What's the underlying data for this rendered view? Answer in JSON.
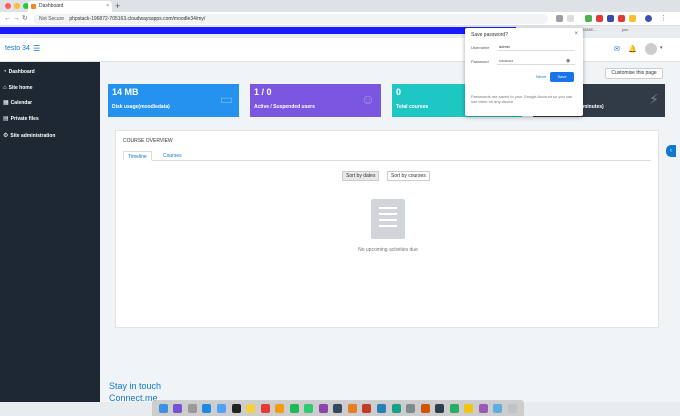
{
  "browser": {
    "tab_title": "Dashboard",
    "tab_close": "×",
    "new_tab": "+",
    "url_secure": "Not Secure",
    "url_text": "phpstack-196872-705163.cloudwaysapps.com/moodle34/my/",
    "bookmarks": [
      "SMS MANAGEME...",
      "jom"
    ]
  },
  "header": {
    "brand": "testo 34",
    "menu_icon": "☰",
    "messages_icon": "✉",
    "notifications_icon": "🔔",
    "user_caret": "▾"
  },
  "sidebar": {
    "items": [
      {
        "label": "Dashboard",
        "icon": "◔"
      },
      {
        "label": "Site home",
        "icon": "⌂"
      },
      {
        "label": "Calendar",
        "icon": "▦"
      },
      {
        "label": "Private files",
        "icon": "▤"
      },
      {
        "label": "Site administration",
        "icon": "⚙"
      }
    ]
  },
  "main": {
    "customise_label": "Customise this page",
    "stats": [
      {
        "value": "14 MB",
        "label": "Disk usage(moodledata)",
        "color": "#2592f0"
      },
      {
        "value": "1 / 0",
        "label": "Active / Suspended users",
        "color": "#7b56e0"
      },
      {
        "value": "0",
        "label": "Total courses",
        "color": "#1fc7c4"
      },
      {
        "value": "",
        "label": "(5 minutes)",
        "color": "#313b48"
      }
    ],
    "course_overview": {
      "title": "COURSE OVERVIEW",
      "tabs": [
        "Timeline",
        "Courses"
      ],
      "sort_buttons": [
        "Sort by dates",
        "Sort by courses"
      ],
      "empty_text": "No upcoming activities due"
    },
    "footer": {
      "stay_in_touch": "Stay in touch",
      "connect": "Connect.me"
    }
  },
  "password_popup": {
    "title": "Save password?",
    "close": "×",
    "username_label": "Username",
    "username_value": "admin",
    "password_label": "Password",
    "password_value": "••••••••••",
    "never_label": "Never",
    "save_label": "Save",
    "note": "Passwords are saved to your Google Account so you can use them on any device"
  },
  "colors": {
    "accent": "#1177d1",
    "sidebar": "#1e2833",
    "top_strip": "#1a1aff"
  }
}
